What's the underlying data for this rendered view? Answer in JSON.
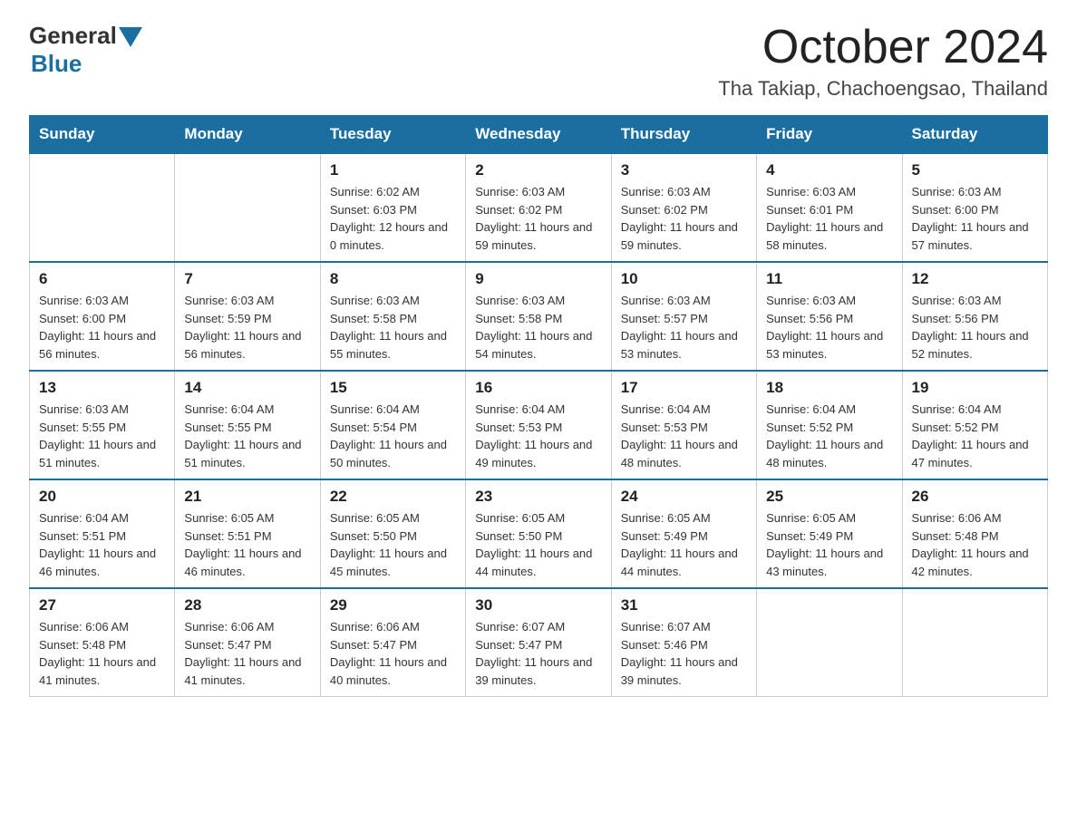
{
  "logo": {
    "general": "General",
    "triangle_color": "#1a6fa0",
    "blue": "Blue"
  },
  "title": "October 2024",
  "location": "Tha Takiap, Chachoengsao, Thailand",
  "days_of_week": [
    "Sunday",
    "Monday",
    "Tuesday",
    "Wednesday",
    "Thursday",
    "Friday",
    "Saturday"
  ],
  "weeks": [
    [
      {
        "day": "",
        "sunrise": "",
        "sunset": "",
        "daylight": ""
      },
      {
        "day": "",
        "sunrise": "",
        "sunset": "",
        "daylight": ""
      },
      {
        "day": "1",
        "sunrise": "Sunrise: 6:02 AM",
        "sunset": "Sunset: 6:03 PM",
        "daylight": "Daylight: 12 hours and 0 minutes."
      },
      {
        "day": "2",
        "sunrise": "Sunrise: 6:03 AM",
        "sunset": "Sunset: 6:02 PM",
        "daylight": "Daylight: 11 hours and 59 minutes."
      },
      {
        "day": "3",
        "sunrise": "Sunrise: 6:03 AM",
        "sunset": "Sunset: 6:02 PM",
        "daylight": "Daylight: 11 hours and 59 minutes."
      },
      {
        "day": "4",
        "sunrise": "Sunrise: 6:03 AM",
        "sunset": "Sunset: 6:01 PM",
        "daylight": "Daylight: 11 hours and 58 minutes."
      },
      {
        "day": "5",
        "sunrise": "Sunrise: 6:03 AM",
        "sunset": "Sunset: 6:00 PM",
        "daylight": "Daylight: 11 hours and 57 minutes."
      }
    ],
    [
      {
        "day": "6",
        "sunrise": "Sunrise: 6:03 AM",
        "sunset": "Sunset: 6:00 PM",
        "daylight": "Daylight: 11 hours and 56 minutes."
      },
      {
        "day": "7",
        "sunrise": "Sunrise: 6:03 AM",
        "sunset": "Sunset: 5:59 PM",
        "daylight": "Daylight: 11 hours and 56 minutes."
      },
      {
        "day": "8",
        "sunrise": "Sunrise: 6:03 AM",
        "sunset": "Sunset: 5:58 PM",
        "daylight": "Daylight: 11 hours and 55 minutes."
      },
      {
        "day": "9",
        "sunrise": "Sunrise: 6:03 AM",
        "sunset": "Sunset: 5:58 PM",
        "daylight": "Daylight: 11 hours and 54 minutes."
      },
      {
        "day": "10",
        "sunrise": "Sunrise: 6:03 AM",
        "sunset": "Sunset: 5:57 PM",
        "daylight": "Daylight: 11 hours and 53 minutes."
      },
      {
        "day": "11",
        "sunrise": "Sunrise: 6:03 AM",
        "sunset": "Sunset: 5:56 PM",
        "daylight": "Daylight: 11 hours and 53 minutes."
      },
      {
        "day": "12",
        "sunrise": "Sunrise: 6:03 AM",
        "sunset": "Sunset: 5:56 PM",
        "daylight": "Daylight: 11 hours and 52 minutes."
      }
    ],
    [
      {
        "day": "13",
        "sunrise": "Sunrise: 6:03 AM",
        "sunset": "Sunset: 5:55 PM",
        "daylight": "Daylight: 11 hours and 51 minutes."
      },
      {
        "day": "14",
        "sunrise": "Sunrise: 6:04 AM",
        "sunset": "Sunset: 5:55 PM",
        "daylight": "Daylight: 11 hours and 51 minutes."
      },
      {
        "day": "15",
        "sunrise": "Sunrise: 6:04 AM",
        "sunset": "Sunset: 5:54 PM",
        "daylight": "Daylight: 11 hours and 50 minutes."
      },
      {
        "day": "16",
        "sunrise": "Sunrise: 6:04 AM",
        "sunset": "Sunset: 5:53 PM",
        "daylight": "Daylight: 11 hours and 49 minutes."
      },
      {
        "day": "17",
        "sunrise": "Sunrise: 6:04 AM",
        "sunset": "Sunset: 5:53 PM",
        "daylight": "Daylight: 11 hours and 48 minutes."
      },
      {
        "day": "18",
        "sunrise": "Sunrise: 6:04 AM",
        "sunset": "Sunset: 5:52 PM",
        "daylight": "Daylight: 11 hours and 48 minutes."
      },
      {
        "day": "19",
        "sunrise": "Sunrise: 6:04 AM",
        "sunset": "Sunset: 5:52 PM",
        "daylight": "Daylight: 11 hours and 47 minutes."
      }
    ],
    [
      {
        "day": "20",
        "sunrise": "Sunrise: 6:04 AM",
        "sunset": "Sunset: 5:51 PM",
        "daylight": "Daylight: 11 hours and 46 minutes."
      },
      {
        "day": "21",
        "sunrise": "Sunrise: 6:05 AM",
        "sunset": "Sunset: 5:51 PM",
        "daylight": "Daylight: 11 hours and 46 minutes."
      },
      {
        "day": "22",
        "sunrise": "Sunrise: 6:05 AM",
        "sunset": "Sunset: 5:50 PM",
        "daylight": "Daylight: 11 hours and 45 minutes."
      },
      {
        "day": "23",
        "sunrise": "Sunrise: 6:05 AM",
        "sunset": "Sunset: 5:50 PM",
        "daylight": "Daylight: 11 hours and 44 minutes."
      },
      {
        "day": "24",
        "sunrise": "Sunrise: 6:05 AM",
        "sunset": "Sunset: 5:49 PM",
        "daylight": "Daylight: 11 hours and 44 minutes."
      },
      {
        "day": "25",
        "sunrise": "Sunrise: 6:05 AM",
        "sunset": "Sunset: 5:49 PM",
        "daylight": "Daylight: 11 hours and 43 minutes."
      },
      {
        "day": "26",
        "sunrise": "Sunrise: 6:06 AM",
        "sunset": "Sunset: 5:48 PM",
        "daylight": "Daylight: 11 hours and 42 minutes."
      }
    ],
    [
      {
        "day": "27",
        "sunrise": "Sunrise: 6:06 AM",
        "sunset": "Sunset: 5:48 PM",
        "daylight": "Daylight: 11 hours and 41 minutes."
      },
      {
        "day": "28",
        "sunrise": "Sunrise: 6:06 AM",
        "sunset": "Sunset: 5:47 PM",
        "daylight": "Daylight: 11 hours and 41 minutes."
      },
      {
        "day": "29",
        "sunrise": "Sunrise: 6:06 AM",
        "sunset": "Sunset: 5:47 PM",
        "daylight": "Daylight: 11 hours and 40 minutes."
      },
      {
        "day": "30",
        "sunrise": "Sunrise: 6:07 AM",
        "sunset": "Sunset: 5:47 PM",
        "daylight": "Daylight: 11 hours and 39 minutes."
      },
      {
        "day": "31",
        "sunrise": "Sunrise: 6:07 AM",
        "sunset": "Sunset: 5:46 PM",
        "daylight": "Daylight: 11 hours and 39 minutes."
      },
      {
        "day": "",
        "sunrise": "",
        "sunset": "",
        "daylight": ""
      },
      {
        "day": "",
        "sunrise": "",
        "sunset": "",
        "daylight": ""
      }
    ]
  ]
}
